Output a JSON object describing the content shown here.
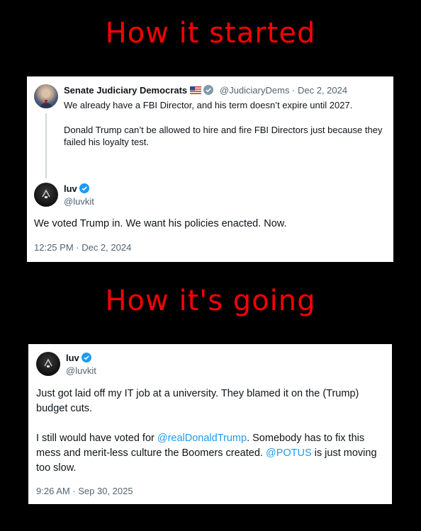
{
  "meme": {
    "top_title": "How it started",
    "bottom_title": "How it's going"
  },
  "tweet1": {
    "quoted": {
      "name": "Senate Judiciary Democrats",
      "handle_date": "@JudiciaryDems · Dec 2, 2024",
      "line1": "We already have a FBI Director, and his term doesn’t expire until 2027.",
      "line2": "Donald Trump can’t be allowed to hire and fire FBI Directors just because they failed his loyalty test."
    },
    "reply": {
      "name": "luv",
      "handle": "@luvkit",
      "text": "We voted Trump in. We want his policies enacted. Now.",
      "timestamp": "12:25 PM · Dec 2, 2024"
    }
  },
  "tweet2": {
    "name": "luv",
    "handle": "@luvkit",
    "para1": "Just got laid off my IT job at a university. They blamed it on the (Trump) budget cuts.",
    "para2_a": "I still would have voted for ",
    "mention1": "@realDonaldTrump",
    "para2_b": ". Somebody has to fix this mess and merit-less culture the Boomers created. ",
    "mention2": "@POTUS",
    "para2_c": " is just moving too slow.",
    "timestamp": "9:26 AM · Sep 30, 2025"
  },
  "colors": {
    "title": "#ff0000",
    "link": "#1d9bf0",
    "verified": "#1d9bf0",
    "muted": "#536471"
  },
  "icons": [
    "us-flag-icon",
    "verified-badge-icon"
  ]
}
